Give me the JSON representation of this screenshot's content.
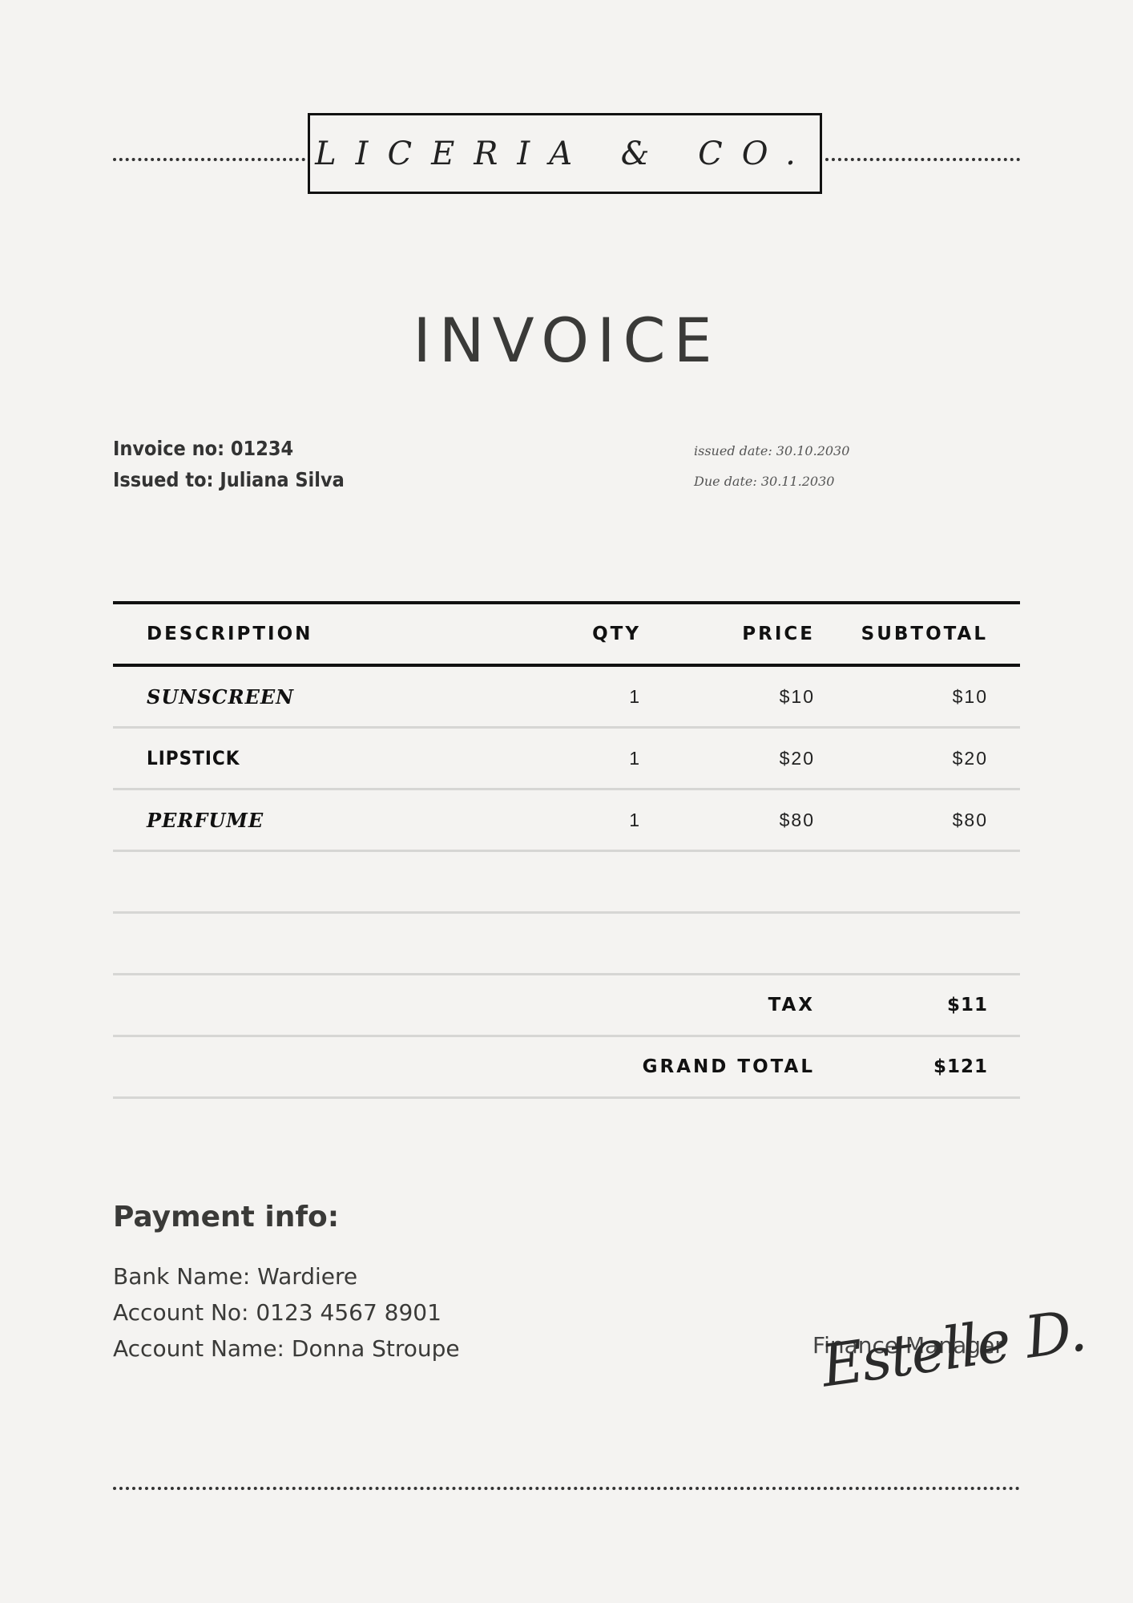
{
  "brand": {
    "name": "LICERIA & CO."
  },
  "title": "INVOICE",
  "meta": {
    "invoice_no": "Invoice no: 01234",
    "issued_to": "Issued to: Juliana Silva",
    "issued_date": "issued date: 30.10.2030",
    "due_date": "Due date: 30.11.2030"
  },
  "table": {
    "headers": {
      "description": "DESCRIPTION",
      "qty": "QTY",
      "price": "PRICE",
      "subtotal": "SUBTOTAL"
    },
    "items": [
      {
        "description": "SUNSCREEN",
        "qty": "1",
        "price": "$10",
        "subtotal": "$10"
      },
      {
        "description": "LIPSTICK",
        "qty": "1",
        "price": "$20",
        "subtotal": "$20"
      },
      {
        "description": "PERFUME",
        "qty": "1",
        "price": "$80",
        "subtotal": "$80"
      }
    ],
    "tax_label": "TAX",
    "tax_value": "$11",
    "grand_total_label": "GRAND TOTAL",
    "grand_total_value": "$121"
  },
  "payment": {
    "title": "Payment info:",
    "bank_name": "Bank Name: Wardiere",
    "account_no": "Account No: 0123 4567 8901",
    "account_name": "Account Name: Donna Stroupe"
  },
  "signature": {
    "role": "Finance Manager",
    "signature_text": "Estelle D."
  }
}
